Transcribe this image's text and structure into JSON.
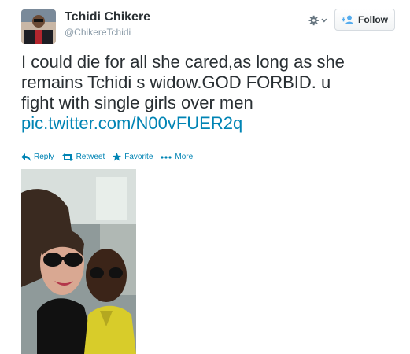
{
  "user": {
    "display_name": "Tchidi Chikere",
    "screen_name": "@ChikereTchidi"
  },
  "header": {
    "follow_label": "Follow",
    "follow_icon": "add-user-icon",
    "settings_icon": "gear-icon"
  },
  "tweet": {
    "line1": "I could die for all she cared,as long as she",
    "line2": "remains Tchidi s widow.GOD FORBID. u",
    "line3": "fight with single girls over men",
    "link": "pic.twitter.com/N00vFUER2q"
  },
  "actions": {
    "reply": "Reply",
    "retweet": "Retweet",
    "favorite": "Favorite",
    "more": "More"
  },
  "colors": {
    "link": "#0084b4",
    "text": "#292f33",
    "muted": "#8899a6"
  }
}
